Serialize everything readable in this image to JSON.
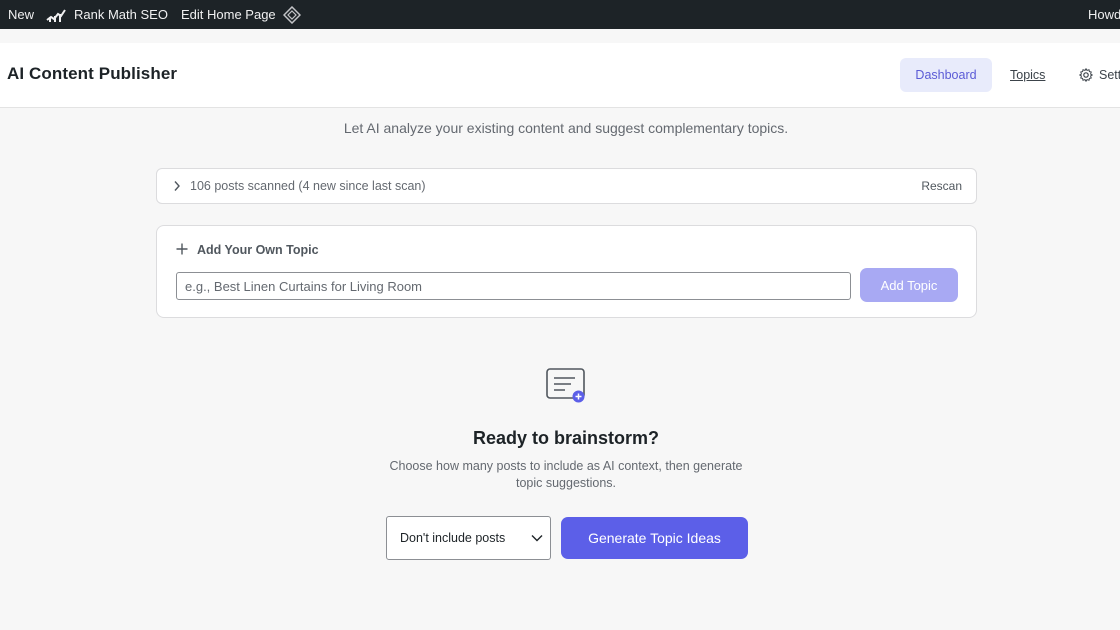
{
  "adminbar": {
    "new_label": "New",
    "rank_math_label": "Rank Math SEO",
    "edit_label": "Edit Home Page",
    "howdy_label": "Howd"
  },
  "header": {
    "title": "AI Content Publisher",
    "nav": {
      "dashboard": "Dashboard",
      "topics": "Topics",
      "settings": "Sett"
    }
  },
  "intro_text": "Let AI analyze your existing content and suggest complementary topics.",
  "scan": {
    "summary": "106 posts scanned (4 new since last scan)",
    "rescan_label": "Rescan"
  },
  "add_topic": {
    "label": "Add Your Own Topic",
    "placeholder": "e.g., Best Linen Curtains for Living Room",
    "value": "",
    "button_label": "Add Topic"
  },
  "empty_state": {
    "title": "Ready to brainstorm?",
    "description": "Choose how many posts to include as AI context, then generate topic suggestions.",
    "select_value": "Don't include posts",
    "generate_label": "Generate Topic Ideas"
  },
  "colors": {
    "adminbar_bg": "#1d2327",
    "accent": "#5c5fe8",
    "accent_disabled": "#a8a9f3",
    "nav_active_bg": "#e8ebfb"
  }
}
